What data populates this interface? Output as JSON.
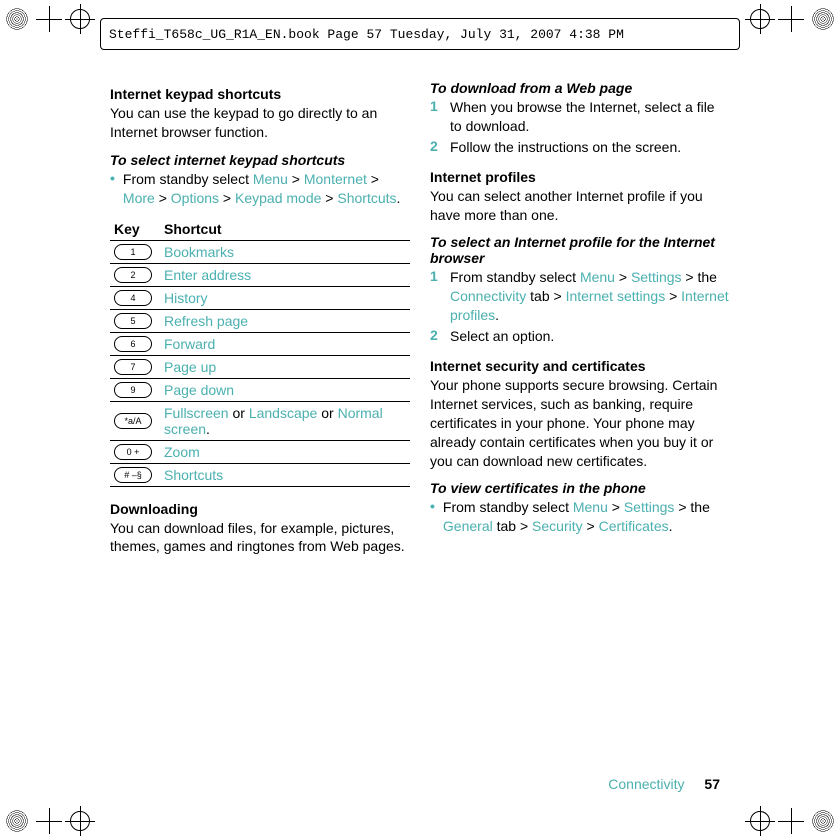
{
  "header": {
    "filename_line": "Steffi_T658c_UG_R1A_EN.book  Page 57  Tuesday, July 31, 2007  4:38 PM"
  },
  "left": {
    "heading1": "Internet keypad shortcuts",
    "para1": "You can use the keypad to go directly to an Internet browser function.",
    "subheading1": "To select internet keypad shortcuts",
    "bullet1_prefix": "From standby select ",
    "bullet1_links": {
      "l1": "Menu",
      "gt1": " > ",
      "l2": "Monternet",
      "gt2": " > ",
      "l3": "More",
      "gt3": " > ",
      "l4": "Options",
      "gt4": " > ",
      "l5": "Keypad mode",
      "gt5": " > ",
      "l6": "Shortcuts",
      "end": "."
    },
    "table": {
      "header_key": "Key",
      "header_sc": "Shortcut",
      "rows": [
        {
          "key": "1",
          "shortcut_plain": "",
          "shortcut": "Bookmarks"
        },
        {
          "key": "2",
          "shortcut_plain": "",
          "shortcut": "Enter address"
        },
        {
          "key": "4",
          "shortcut_plain": "",
          "shortcut": "History"
        },
        {
          "key": "5",
          "shortcut_plain": "",
          "shortcut": "Refresh page"
        },
        {
          "key": "6",
          "shortcut_plain": "",
          "shortcut": "Forward"
        },
        {
          "key": "7",
          "shortcut_plain": "",
          "shortcut": "Page up"
        },
        {
          "key": "9",
          "shortcut_plain": "",
          "shortcut": "Page down"
        },
        {
          "key": "*a/A",
          "shortcut": "Fullscreen",
          "mid1": " or ",
          "shortcut2": "Landscape",
          "mid2": " or ",
          "shortcut3": "Normal screen",
          "end": "."
        },
        {
          "key": "0 +",
          "shortcut_plain": "",
          "shortcut": "Zoom"
        },
        {
          "key": "# –§",
          "shortcut_plain": "",
          "shortcut": "Shortcuts"
        }
      ]
    },
    "heading2": "Downloading",
    "para2": "You can download files, for example, pictures, themes, games and ringtones from Web pages."
  },
  "right": {
    "subheading1": "To download from a Web page",
    "step1_a": "When you browse the Internet, select a file to download.",
    "step1_n": "1",
    "step2_a": "Follow the instructions on the screen.",
    "step2_n": "2",
    "heading1": "Internet profiles",
    "para1": "You can select another Internet profile if you have more than one.",
    "subheading2": "To select an Internet profile for the Internet browser",
    "stepB1_n": "1",
    "stepB1_prefix": "From standby select ",
    "stepB1_links": {
      "l1": "Menu",
      "gt1": " > ",
      "l2": "Settings",
      "gt2": " > the ",
      "l3": "Connectivity",
      "gt3": " tab > ",
      "l4": "Internet settings",
      "gt4": " > ",
      "l5": "Internet profiles",
      "end": "."
    },
    "stepB2_n": "2",
    "stepB2_a": "Select an option.",
    "heading2": "Internet security and certificates",
    "para2": "Your phone supports secure browsing. Certain Internet services, such as banking, require certificates in your phone. Your phone may already contain certificates when you buy it or you can download new certificates.",
    "subheading3": "To view certificates in the phone",
    "bulletC_prefix": "From standby select ",
    "bulletC_links": {
      "l1": "Menu",
      "gt1": " > ",
      "l2": "Settings",
      "gt2": " > the ",
      "l3": "General",
      "gt3": " tab > ",
      "l4": "Security",
      "gt4": " > ",
      "l5": "Certificates",
      "end": "."
    }
  },
  "footer": {
    "section": "Connectivity",
    "page": "57"
  }
}
